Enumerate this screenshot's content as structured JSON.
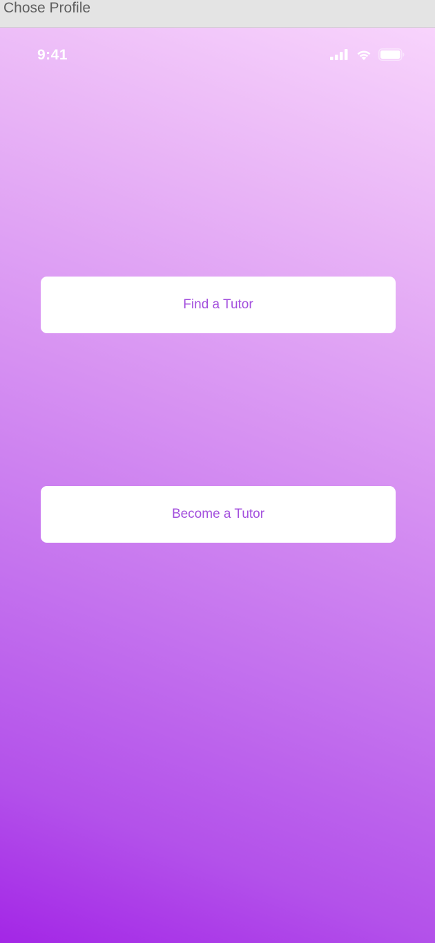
{
  "frame": {
    "label": "Chose Profile"
  },
  "status_bar": {
    "time": "9:41",
    "icons": [
      "signal-icon",
      "wifi-icon",
      "battery-icon"
    ]
  },
  "profile_choices": {
    "find_tutor_label": "Find a Tutor",
    "become_tutor_label": "Become a Tutor"
  },
  "colors": {
    "gradient_top": "#f8d4fc",
    "gradient_bottom": "#a326e6",
    "button_background": "#ffffff",
    "button_text": "#a34fdd",
    "status_text": "#ffffff"
  }
}
